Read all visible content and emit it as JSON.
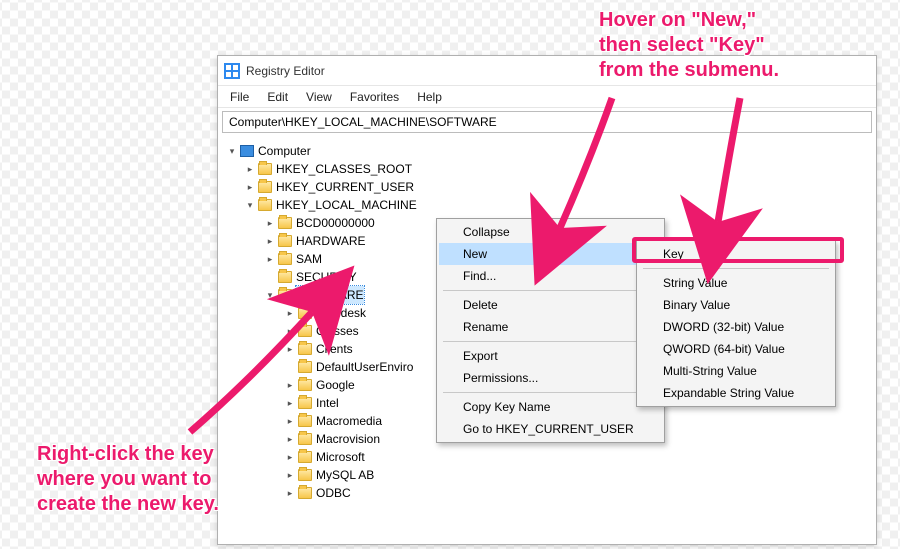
{
  "window": {
    "title": "Registry Editor"
  },
  "menubar": [
    "File",
    "Edit",
    "View",
    "Favorites",
    "Help"
  ],
  "address": "Computer\\HKEY_LOCAL_MACHINE\\SOFTWARE",
  "tree": {
    "root": "Computer",
    "hives": [
      {
        "label": "HKEY_CLASSES_ROOT",
        "expandable": true
      },
      {
        "label": "HKEY_CURRENT_USER",
        "expandable": true
      },
      {
        "label": "HKEY_LOCAL_MACHINE",
        "expandable": true,
        "expanded": true,
        "children": [
          {
            "label": "BCD00000000",
            "expandable": true
          },
          {
            "label": "HARDWARE",
            "expandable": true
          },
          {
            "label": "SAM",
            "expandable": true
          },
          {
            "label": "SECURITY",
            "expandable": false
          },
          {
            "label": "SOFTWARE",
            "expandable": true,
            "expanded": true,
            "selected": true,
            "children": [
              {
                "label": "Autodesk",
                "expandable": true
              },
              {
                "label": "Classes",
                "expandable": true
              },
              {
                "label": "Clients",
                "expandable": true
              },
              {
                "label": "DefaultUserEnviro",
                "expandable": false
              },
              {
                "label": "Google",
                "expandable": true
              },
              {
                "label": "Intel",
                "expandable": true
              },
              {
                "label": "Macromedia",
                "expandable": true
              },
              {
                "label": "Macrovision",
                "expandable": true
              },
              {
                "label": "Microsoft",
                "expandable": true
              },
              {
                "label": "MySQL AB",
                "expandable": true
              },
              {
                "label": "ODBC",
                "expandable": true
              }
            ]
          }
        ]
      }
    ]
  },
  "context_menu": {
    "items": [
      {
        "label": "Collapse"
      },
      {
        "label": "New",
        "highlight": true,
        "submenu": true
      },
      {
        "label": "Find..."
      },
      {
        "sep": true
      },
      {
        "label": "Delete"
      },
      {
        "label": "Rename"
      },
      {
        "sep": true
      },
      {
        "label": "Export"
      },
      {
        "label": "Permissions..."
      },
      {
        "sep": true
      },
      {
        "label": "Copy Key Name"
      },
      {
        "label": "Go to HKEY_CURRENT_USER"
      }
    ]
  },
  "submenu": {
    "items": [
      {
        "label": "Key",
        "boxed": true
      },
      {
        "sep": true
      },
      {
        "label": "String Value"
      },
      {
        "label": "Binary Value"
      },
      {
        "label": "DWORD (32-bit) Value"
      },
      {
        "label": "QWORD (64-bit) Value"
      },
      {
        "label": "Multi-String Value"
      },
      {
        "label": "Expandable String Value"
      }
    ]
  },
  "annotations": {
    "top": "Hover on \"New,\"\nthen select \"Key\"\nfrom the submenu.",
    "bottom": "Right-click the key\nwhere you want to\ncreate the new key."
  }
}
